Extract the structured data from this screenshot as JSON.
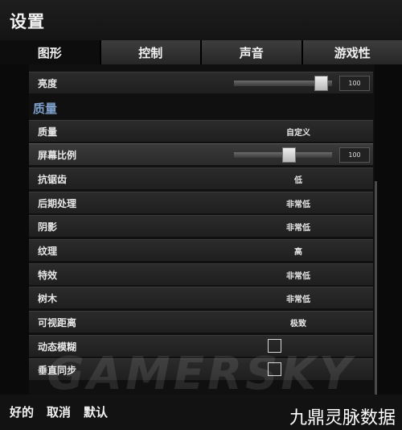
{
  "header": {
    "title": "设置"
  },
  "tabs": [
    {
      "label": "图形",
      "active": true
    },
    {
      "label": "控制",
      "active": false
    },
    {
      "label": "声音",
      "active": false
    },
    {
      "label": "游戏性",
      "active": false
    }
  ],
  "brightness": {
    "label": "亮度",
    "value": "100",
    "slider_fraction": 0.95
  },
  "section": {
    "title": "质量"
  },
  "quality": {
    "label": "质量",
    "value": "自定义"
  },
  "screen_ratio": {
    "label": "屏幕比例",
    "value": "100",
    "slider_fraction": 0.57
  },
  "antialiasing": {
    "label": "抗锯齿",
    "value": "低"
  },
  "post_processing": {
    "label": "后期处理",
    "value": "非常低"
  },
  "shadows": {
    "label": "阴影",
    "value": "非常低"
  },
  "textures": {
    "label": "纹理",
    "value": "高"
  },
  "effects": {
    "label": "特效",
    "value": "非常低"
  },
  "trees": {
    "label": "树木",
    "value": "非常低"
  },
  "view_distance": {
    "label": "可视距离",
    "value": "极致"
  },
  "motion_blur": {
    "label": "动态模糊",
    "checked": false
  },
  "vsync": {
    "label": "垂直同步",
    "checked": false
  },
  "footer": {
    "ok": "好的",
    "cancel": "取消",
    "default": "默认"
  },
  "watermark": {
    "text": "GAMERSKY"
  },
  "corner_watermark": {
    "text": "九鼎灵脉数据"
  },
  "colors": {
    "section_title": "#7fa0cc",
    "background": "#0a0a0a"
  }
}
